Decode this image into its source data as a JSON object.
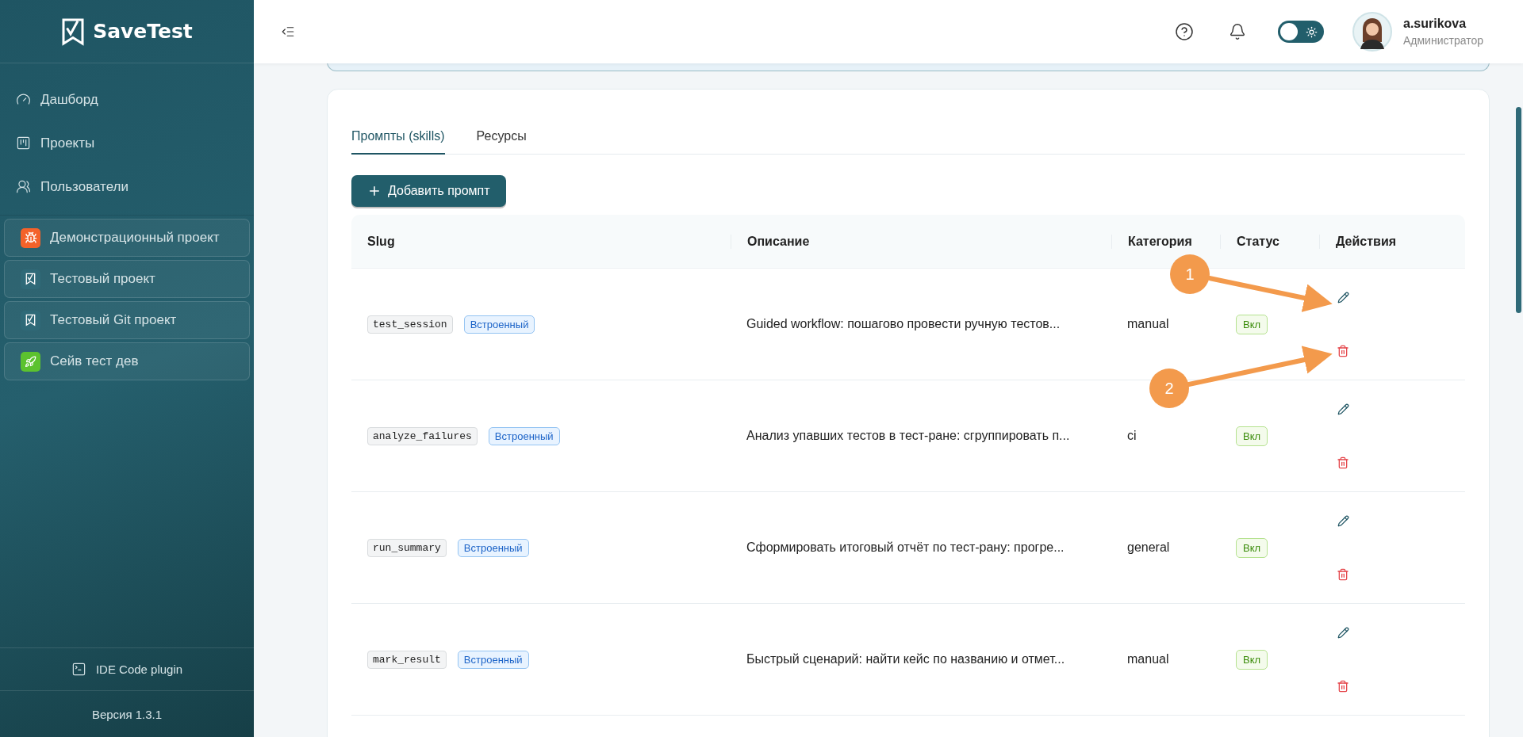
{
  "sidebar": {
    "logo": "SaveTest",
    "nav": [
      {
        "label": "Дашборд",
        "kind": "dashboard"
      },
      {
        "label": "Проекты",
        "kind": "projects"
      },
      {
        "label": "Пользователи",
        "kind": "users"
      }
    ],
    "projects": [
      {
        "name": "Демонстрационный проект",
        "kind": "bug",
        "color": "#f4622a"
      },
      {
        "name": "Тестовый проект",
        "kind": "logo",
        "color": "#2f6a78"
      },
      {
        "name": "Тестовый Git проект",
        "kind": "logo",
        "color": "#2f6a78"
      },
      {
        "name": "Сейв тест дев",
        "kind": "rocket",
        "color": "#5cc22f"
      }
    ],
    "plugin": "IDE Code plugin",
    "version": "Версия 1.3.1"
  },
  "header": {
    "theme_toggle": {
      "on": false
    },
    "user": {
      "name": "a.surikova",
      "role": "Администратор"
    }
  },
  "tabs": [
    {
      "label": "Промпты (skills)",
      "selected": true
    },
    {
      "label": "Ресурсы",
      "selected": false
    }
  ],
  "add_button": "Добавить промпт",
  "table": {
    "columns": [
      "Slug",
      "Описание",
      "Категория",
      "Статус",
      "Действия"
    ],
    "rows": [
      {
        "slug": "test_session",
        "badge": "Встроенный",
        "description": "Guided workflow: пошагово провести ручную тестов...",
        "category": "manual",
        "status": "Вкл"
      },
      {
        "slug": "analyze_failures",
        "badge": "Встроенный",
        "description": "Анализ упавших тестов в тест-ране: сгруппировать п...",
        "category": "ci",
        "status": "Вкл"
      },
      {
        "slug": "run_summary",
        "badge": "Встроенный",
        "description": "Сформировать итоговый отчёт по тест-рану: прогре...",
        "category": "general",
        "status": "Вкл"
      },
      {
        "slug": "mark_result",
        "badge": "Встроенный",
        "description": "Быстрый сценарий: найти кейс по названию и отмет...",
        "category": "manual",
        "status": "Вкл"
      }
    ]
  },
  "callouts": [
    {
      "label": "1"
    },
    {
      "label": "2"
    }
  ]
}
